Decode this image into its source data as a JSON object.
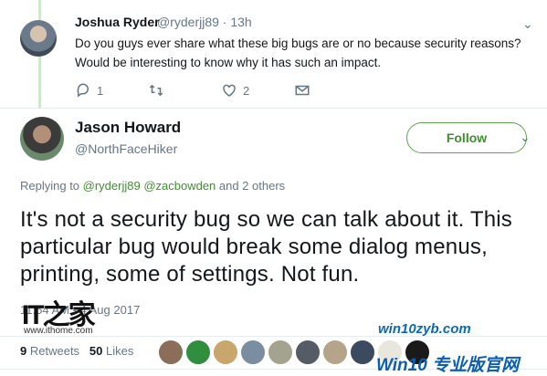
{
  "reply_tweet": {
    "author_name": "Joshua Ryder",
    "handle_time": "@ryderjj89 · 13h",
    "text": "Do you guys ever share what these big bugs are or no because security reasons? Would be interesting to know why it has such an impact.",
    "reply_count": "1",
    "retweet_count": "",
    "like_count": "2"
  },
  "main_tweet": {
    "author_name": "Jason Howard",
    "handle": "@NorthFaceHiker",
    "follow_label": "Follow",
    "replying_prefix": "Replying to ",
    "replying_mentions": "@ryderjj89 @zacbowden",
    "replying_suffix": " and 2 others",
    "text": "It's not a security bug so we can talk about it. This particular bug would break some dialog menus, printing, some of settings.  Not fun.",
    "date": "11:54 AM - 4 Aug 2017",
    "retweets_count": "9",
    "retweets_label": "Retweets",
    "likes_count": "50",
    "likes_label": "Likes"
  },
  "watermarks": {
    "ithome_logo": "IT之家",
    "ithome_url": "www.ithome.com",
    "win10_url": "win10zyb.com",
    "win10_name": "Win10 专业版官网"
  },
  "colors": {
    "accent": "#3f8f2f",
    "muted": "#657786",
    "thread_line": "#cfe8cf"
  }
}
